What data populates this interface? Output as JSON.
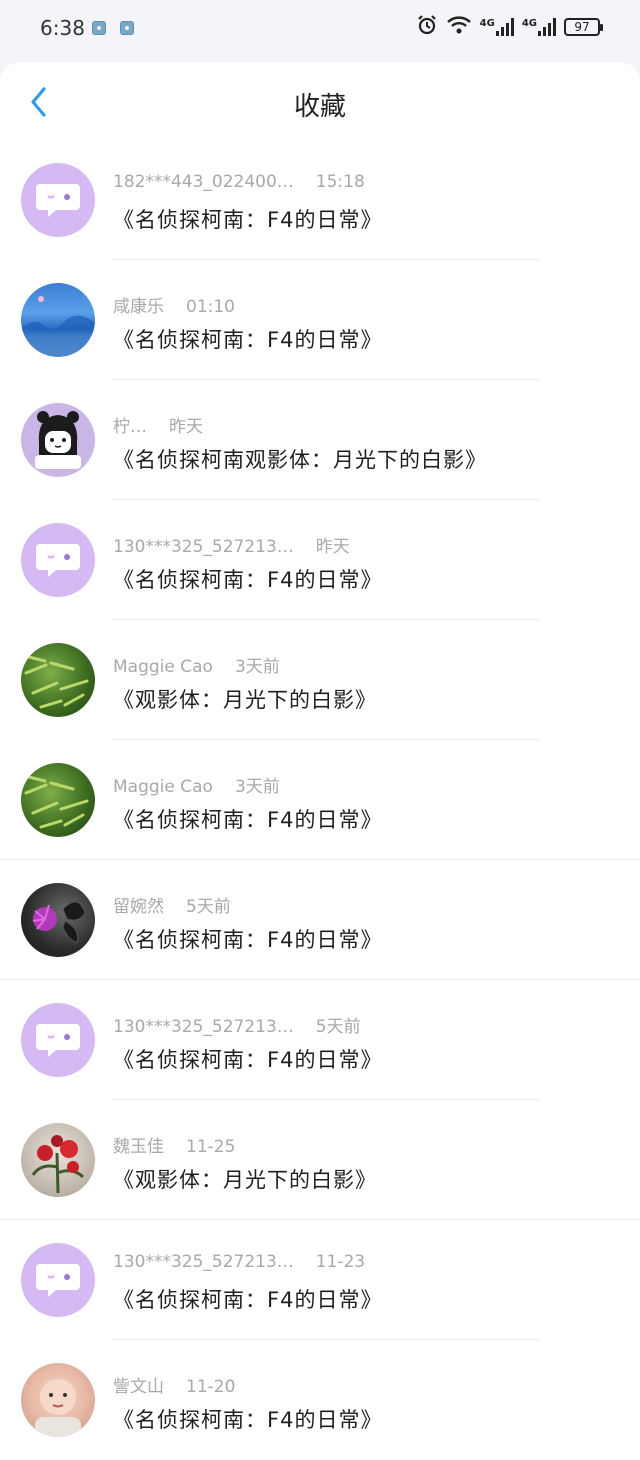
{
  "status": {
    "time": "6:38",
    "battery": "97",
    "network": "4G"
  },
  "header": {
    "title": "收藏"
  },
  "items": [
    {
      "name": "182***443_022400…",
      "time": "15:18",
      "book": "《名侦探柯南：F4的日常》",
      "avatar": "default-chat-avatar"
    },
    {
      "name": "咸康乐",
      "time": "01:10",
      "book": "《名侦探柯南：F4的日常》",
      "avatar": "blue-landscape-photo"
    },
    {
      "name": "柠…",
      "time": "昨天",
      "book": "《名侦探柯南观影体：月光下的白影》",
      "avatar": "cartoon-girl-avatar"
    },
    {
      "name": "130***325_527213…",
      "time": "昨天",
      "book": "《名侦探柯南：F4的日常》",
      "avatar": "default-chat-avatar"
    },
    {
      "name": "Maggie Cao",
      "time": "3天前",
      "book": "《观影体：月光下的白影》",
      "avatar": "green-bamboo-photo"
    },
    {
      "name": "Maggie Cao",
      "time": "3天前",
      "book": "《名侦探柯南：F4的日常》",
      "avatar": "green-bamboo-photo"
    },
    {
      "name": "留婉然",
      "time": "5天前",
      "book": "《名侦探柯南：F4的日常》",
      "avatar": "purple-flower-butterfly-photo"
    },
    {
      "name": "130***325_527213…",
      "time": "5天前",
      "book": "《名侦探柯南：F4的日常》",
      "avatar": "default-chat-avatar"
    },
    {
      "name": "魏玉佳",
      "time": "11-25",
      "book": "《观影体：月光下的白影》",
      "avatar": "red-flower-painting"
    },
    {
      "name": "130***325_527213…",
      "time": "11-23",
      "book": "《名侦探柯南：F4的日常》",
      "avatar": "default-chat-avatar"
    },
    {
      "name": "訾文山",
      "time": "11-20",
      "book": "《名侦探柯南：F4的日常》",
      "avatar": "baby-photo"
    }
  ],
  "colors": {
    "accent": "#2f9bea",
    "default_avatar": "#d4b9f2",
    "background": "#f4f5f9"
  }
}
